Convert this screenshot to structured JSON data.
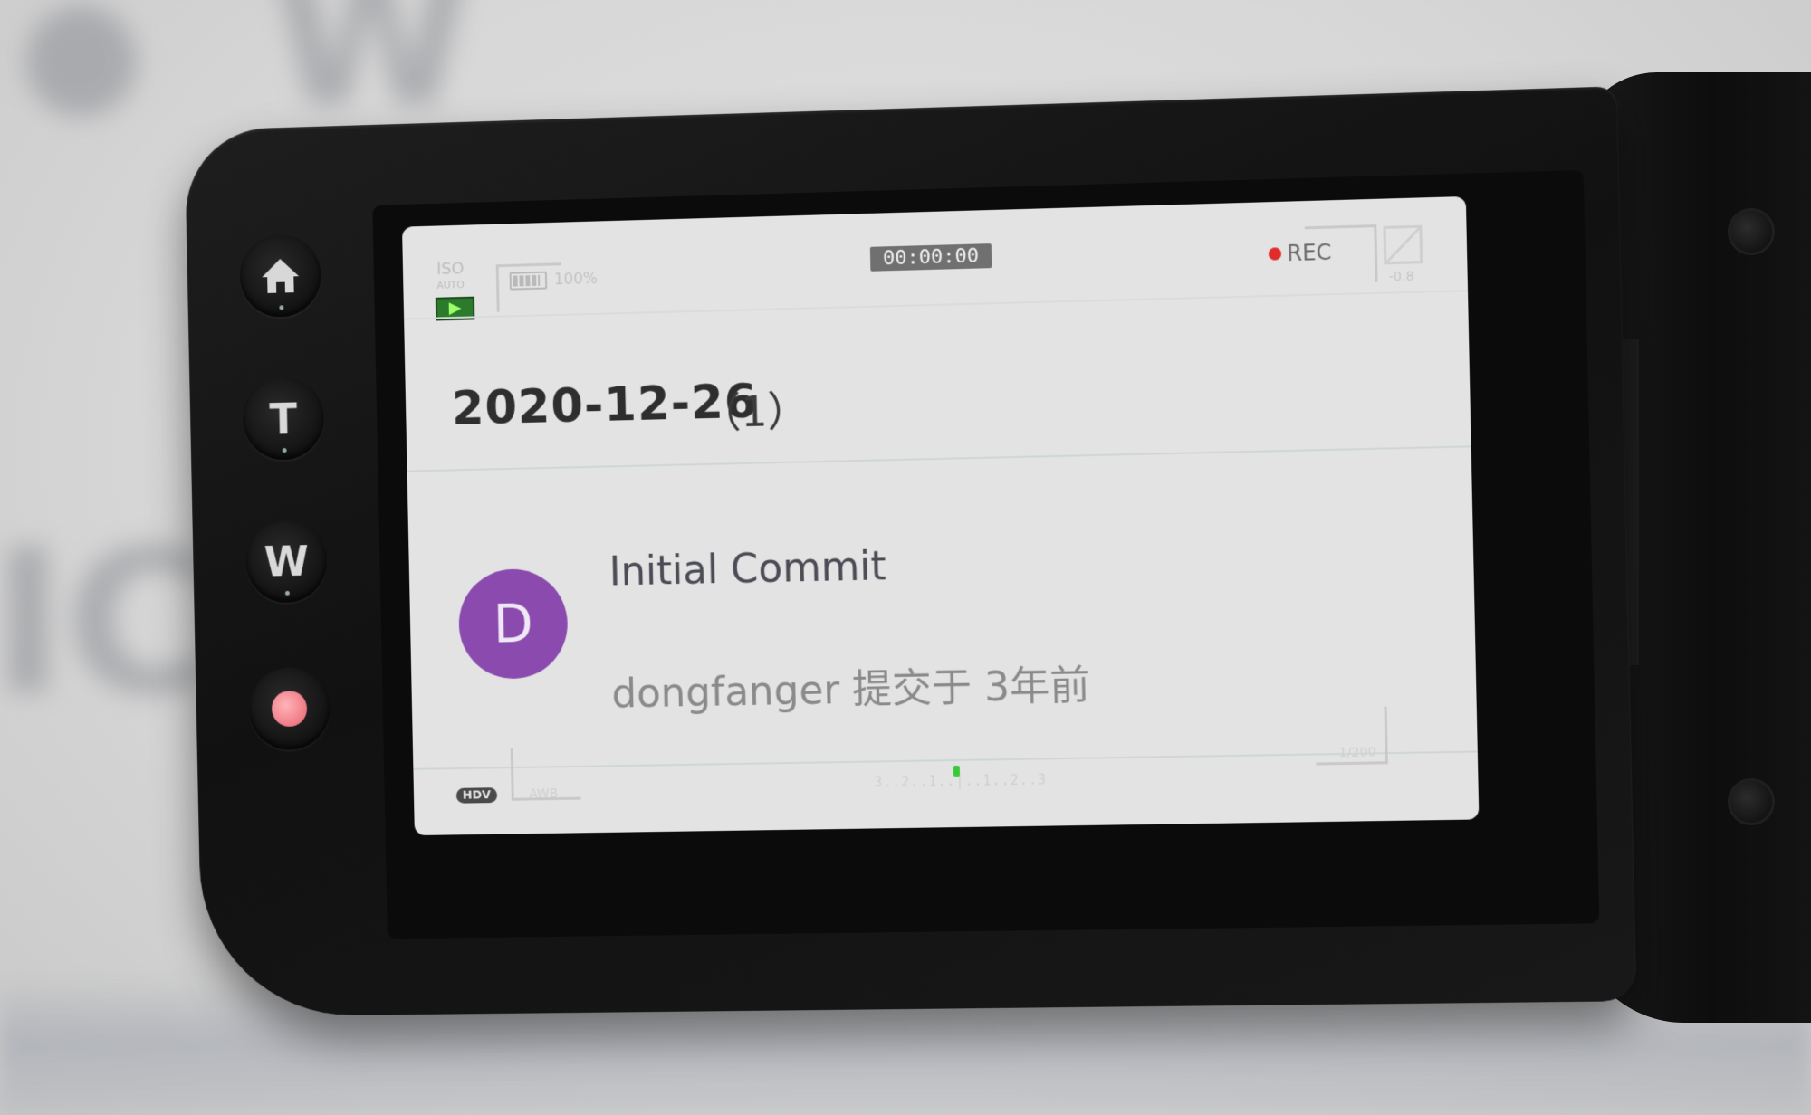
{
  "osd": {
    "iso_label": "ISO",
    "iso_sub": "AUTO",
    "battery_text": "100%",
    "timecode": "00:00:00",
    "rec_label": "REC",
    "ev_value": "-0.8",
    "format_badge": "HDV",
    "awb_label": "AWB",
    "shutter": "1/200",
    "meter_scale": "3..2..1..|..1..2..3"
  },
  "side_buttons": {
    "tele_label": "T",
    "wide_label": "W"
  },
  "commit_group": {
    "date": "2020-12-26",
    "count": "（1）"
  },
  "commit": {
    "avatar_letter": "D",
    "message": "Initial Commit",
    "meta": "dongfanger 提交于 3年前"
  },
  "colors": {
    "avatar_bg": "#8a4aae",
    "rec_dot": "#e22c2c",
    "screen_bg": "#e3e3e3"
  }
}
